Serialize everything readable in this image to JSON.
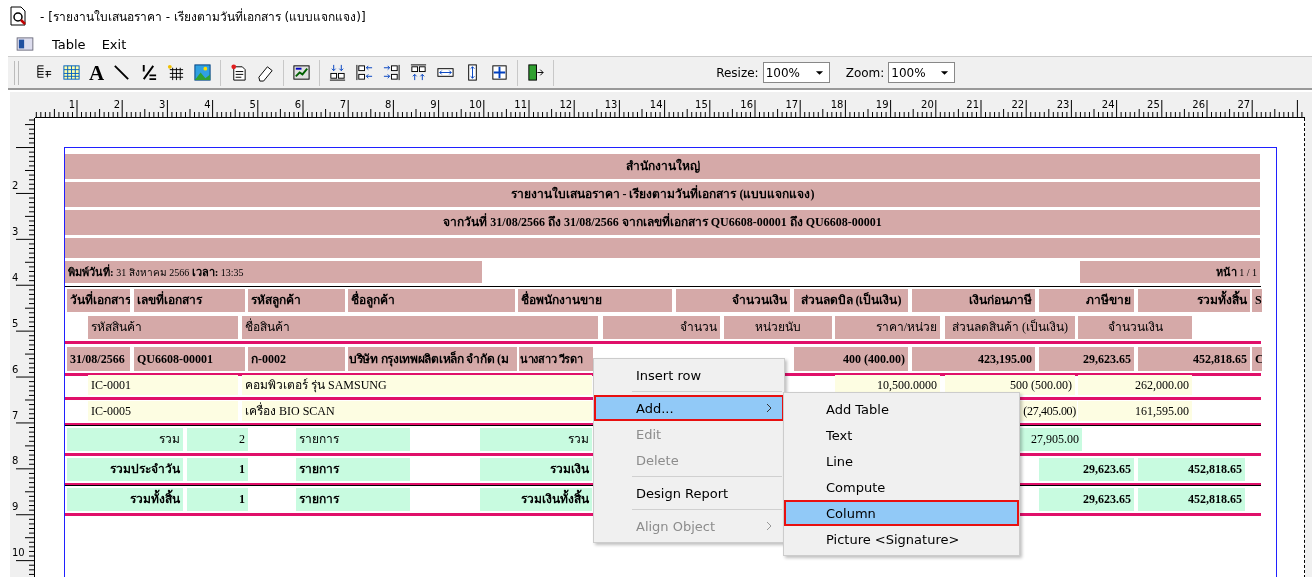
{
  "window": {
    "title": "- [รายงานใบเสนอราคา - เรียงตามวันที่เอกสาร (แบบแจกแจง)]"
  },
  "menu_bar": [
    "Table",
    "Exit"
  ],
  "toolbar": {
    "font_tool": "A",
    "resize": {
      "label": "Resize:",
      "value": "100%"
    },
    "zoom": {
      "label": "Zoom:",
      "value": "100%"
    }
  },
  "ruler": {
    "horizontal": [
      "1",
      "2",
      "3",
      "4",
      "5",
      "6",
      "7",
      "8",
      "9",
      "10",
      "11",
      "12",
      "13",
      "14",
      "15",
      "16",
      "17",
      "18",
      "19",
      "20",
      "21",
      "22",
      "23",
      "24",
      "25",
      "26",
      "27"
    ],
    "vertical": [
      "2",
      "3",
      "4",
      "5",
      "6",
      "7",
      "8",
      "9",
      "10"
    ]
  },
  "report": {
    "header_lines": [
      "สำนักงานใหญ่",
      "รายงานใบเสนอราคา - เรียงตามวันที่เอกสาร (แบบแจกแจง)",
      "**จากวันที่** 31/08/2566 **ถึง** 31/08/2566 **จากเลขที่เอกสาร** QU6608-00001 **ถึง** QU6608-00001"
    ],
    "print_info": "**พิมพ์วันที่:** 31 สิงหาคม 2566 **เวลา:** 13:35",
    "page_info": "**หน้า** 1 / 1",
    "columns_row_1": [
      "วันที่เอกสาร",
      "เลขที่เอกสาร",
      "รหัสลูกค้า",
      "ชื่อลูกค้า",
      "ชื่อพนักงานขาย",
      "จำนวนเงิน",
      "ส่วนลดบิล (เป็นเงิน)",
      "เงินก่อนภาษี",
      "ภาษีขาย",
      "รวมทั้งสิ้น",
      "S"
    ],
    "columns_row_2": [
      "รหัสสินค้า",
      "ชื่อสินค้า",
      "จำนวน",
      "หน่วยนับ",
      "ราคา/หน่วย",
      "ส่วนลดสินค้า (เป็นเงิน)",
      "จำนวนเงิน"
    ],
    "document_row": {
      "date": "31/08/2566",
      "doc_no": "QU6608-00001",
      "customer_code": "ก-0002",
      "customer_name": "บริษัท กรุงเทพผลิตเหล็ก จำกัด (ม",
      "salesperson": "นางสาว วีรดา",
      "bill_discount": "400 (400.00)",
      "before_tax": "423,195.00",
      "vat": "29,623.65",
      "total": "452,818.65",
      "column_s": "C"
    },
    "items": [
      {
        "code": "IC-0001",
        "name": "คอมพิวเตอร์ รุ่น SAMSUNG",
        "unit_price": "10,500.0000",
        "discount": "500 (500.00)",
        "amount": "262,000.00"
      },
      {
        "code": "IC-0005",
        "name": "เครื่อง BIO SCAN",
        "discount": "(27,405.00)",
        "amount": "161,595.00"
      }
    ],
    "summaries": [
      {
        "kind": "group",
        "label": "รวม",
        "count": "2",
        "unit": "รายการ",
        "amount_label": "รวม",
        "subtotal": "27,905.00"
      },
      {
        "kind": "daily",
        "label": "รวมประจำวัน",
        "count": "1",
        "unit": "รายการ",
        "amount_label": "รวมเงิน",
        "vat": "29,623.65",
        "total": "452,818.65"
      },
      {
        "kind": "grand",
        "label": "รวมทั้งสิ้น",
        "count": "1",
        "unit": "รายการ",
        "amount_label": "รวมเงินทั้งสิ้น",
        "vat": "29,623.65",
        "total": "452,818.65"
      }
    ]
  },
  "context_menu": {
    "items": [
      {
        "kind": "item",
        "label": "Insert row",
        "disabled": false,
        "selected": false,
        "submenu": false
      },
      {
        "kind": "separator"
      },
      {
        "kind": "item",
        "label": "Add...",
        "disabled": false,
        "selected": true,
        "submenu": true
      },
      {
        "kind": "item",
        "label": "Edit",
        "disabled": true,
        "selected": false,
        "submenu": false
      },
      {
        "kind": "item",
        "label": "Delete",
        "disabled": true,
        "selected": false,
        "submenu": false
      },
      {
        "kind": "separator"
      },
      {
        "kind": "item",
        "label": "Design Report",
        "disabled": false,
        "selected": false,
        "submenu": false
      },
      {
        "kind": "separator"
      },
      {
        "kind": "item",
        "label": "Align Object",
        "disabled": true,
        "selected": false,
        "submenu": true
      }
    ]
  },
  "submenu": {
    "items": [
      {
        "label": "Add Table",
        "selected": false
      },
      {
        "label": "Text",
        "selected": false
      },
      {
        "label": "Line",
        "selected": false
      },
      {
        "label": "Compute",
        "selected": false
      },
      {
        "label": "Column",
        "selected": true
      },
      {
        "label": "Picture <Signature>",
        "selected": false
      }
    ]
  }
}
